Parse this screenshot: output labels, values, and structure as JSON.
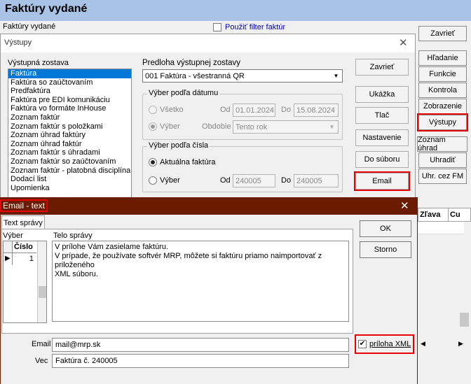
{
  "app": {
    "title": "Faktúry vydané",
    "subtitle": "Faktúry vydané",
    "filter_label": "Použiť filter faktúr"
  },
  "right_buttons": {
    "close": "Zavrieť",
    "search": "Hľadanie",
    "functions": "Funkcie",
    "control": "Kontrola",
    "display": "Zobrazenie",
    "outputs": "Výstupy",
    "payment_list": "Zoznam úhrad",
    "pay": "Uhradiť",
    "pay_fm": "Uhr. cez FM"
  },
  "outputs_dialog": {
    "title": "Výstupy",
    "list_label": "Výstupná zostava",
    "items": [
      "Faktúra",
      "Faktúra so zaúčtovaním",
      "Predfaktúra",
      "Faktúra pre EDI komunikáciu",
      "Faktúra vo formáte InHouse",
      "Zoznam faktúr",
      "Zoznam faktúr s položkami",
      "Zoznam úhrad faktúry",
      "Zoznam úhrad faktúr",
      "Zoznam faktúr s úhradami",
      "Zoznam faktúr so zaúčtovaním",
      "Zoznam faktúr - platobná disciplína",
      "Dodací list",
      "Upomienka"
    ],
    "template_label": "Predloha výstupnej zostavy",
    "template_value": "001 Faktúra - všestranná QR",
    "date_group": {
      "title": "Výber podľa dátumu",
      "all": "Všetko",
      "from_label": "Od",
      "from": "01.01.2024",
      "to_label": "Do",
      "to": "15.08.2024",
      "selection": "Výber",
      "period_label": "Obdobie",
      "period": "Tento rok"
    },
    "number_group": {
      "title": "Výber podľa čísla",
      "current": "Aktuálna faktúra",
      "selection": "Výber",
      "from_label": "Od",
      "from": "240005",
      "to_label": "Do",
      "to": "240005"
    },
    "buttons": {
      "close": "Zavrieť",
      "preview": "Ukážka",
      "print": "Tlač",
      "settings": "Nastavenie",
      "to_file": "Do súboru",
      "email": "Email"
    }
  },
  "email_dialog": {
    "title": "Email - text",
    "tab": "Text správy",
    "selection_label": "Výber",
    "body_label": "Telo správy",
    "grid_header": "Číslo",
    "grid_rows": [
      "1"
    ],
    "body_lines": [
      "V prílohe Vám zasielame faktúru.",
      "V prípade, že používate softvér MRP, môžete si faktúru priamo naimportovať z priloženého",
      "XML súboru."
    ],
    "ok": "OK",
    "cancel": "Storno",
    "email_label": "Email",
    "email_value": "mail@mrp.sk",
    "subject_label": "Vec",
    "subject_value": "Faktúra č. 240005",
    "attach_xml": "príloha XML"
  },
  "background_grid": {
    "col1": "Zľava",
    "col2": "Cu"
  }
}
